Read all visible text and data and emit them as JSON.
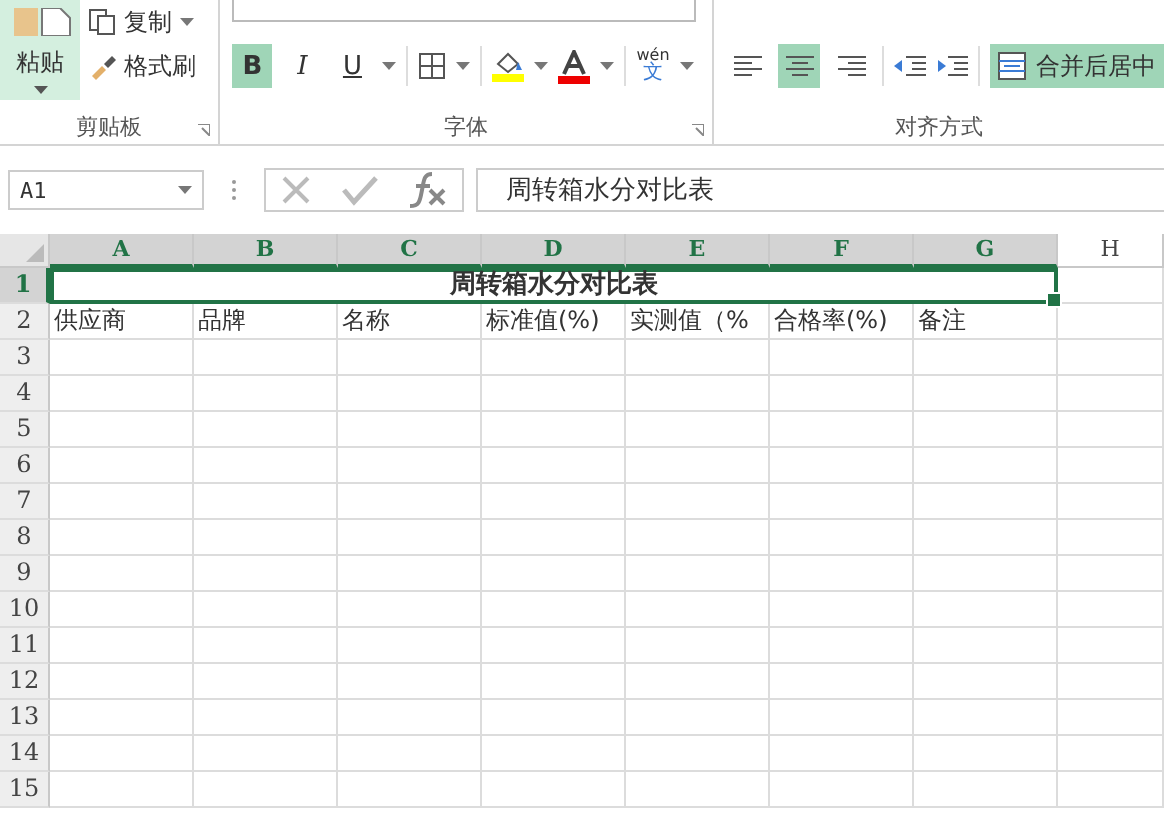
{
  "ribbon": {
    "clipboard": {
      "label": "剪贴板",
      "paste": {
        "label": "粘贴",
        "selected": true
      },
      "items": [
        {
          "kind": "copy",
          "label": "复制"
        },
        {
          "kind": "painter",
          "label": "格式刷"
        }
      ]
    },
    "font": {
      "label": "字体",
      "styles": [
        {
          "kind": "bold",
          "glyph": "B",
          "selected": true
        },
        {
          "kind": "italic",
          "glyph": "I",
          "selected": false
        },
        {
          "kind": "underline",
          "glyph": "U",
          "selected": false
        }
      ],
      "phonetic": {
        "pinyin": "wén",
        "glyph": "文"
      }
    },
    "alignment": {
      "label": "对齐方式",
      "aligns": [
        {
          "kind": "left",
          "selected": false
        },
        {
          "kind": "center",
          "selected": true
        },
        {
          "kind": "right",
          "selected": false
        }
      ],
      "merge": {
        "label": "合并后居中",
        "selected": true
      }
    }
  },
  "formula_bar": {
    "name_box": "A1",
    "value": "周转箱水分对比表"
  },
  "sheet": {
    "columns": [
      {
        "label": "A",
        "selected": true
      },
      {
        "label": "B",
        "selected": true
      },
      {
        "label": "C",
        "selected": true
      },
      {
        "label": "D",
        "selected": true
      },
      {
        "label": "E",
        "selected": true
      },
      {
        "label": "F",
        "selected": true
      },
      {
        "label": "G",
        "selected": true
      },
      {
        "label": "H",
        "selected": false
      }
    ],
    "rows": [
      {
        "number": "1",
        "selected": true,
        "title": "周转箱水分对比表"
      },
      {
        "number": "2",
        "selected": false,
        "cells": [
          "供应商",
          "品牌",
          "名称",
          "标准值(%)",
          "实测值（%",
          "合格率(%)",
          "备注"
        ]
      },
      {
        "number": "3",
        "selected": false
      },
      {
        "number": "4",
        "selected": false
      },
      {
        "number": "5",
        "selected": false
      },
      {
        "number": "6",
        "selected": false
      },
      {
        "number": "7",
        "selected": false
      },
      {
        "number": "8",
        "selected": false
      },
      {
        "number": "9",
        "selected": false
      },
      {
        "number": "10",
        "selected": false
      },
      {
        "number": "11",
        "selected": false
      },
      {
        "number": "12",
        "selected": false
      },
      {
        "number": "13",
        "selected": false
      },
      {
        "number": "14",
        "selected": false
      },
      {
        "number": "15",
        "selected": false
      }
    ]
  }
}
